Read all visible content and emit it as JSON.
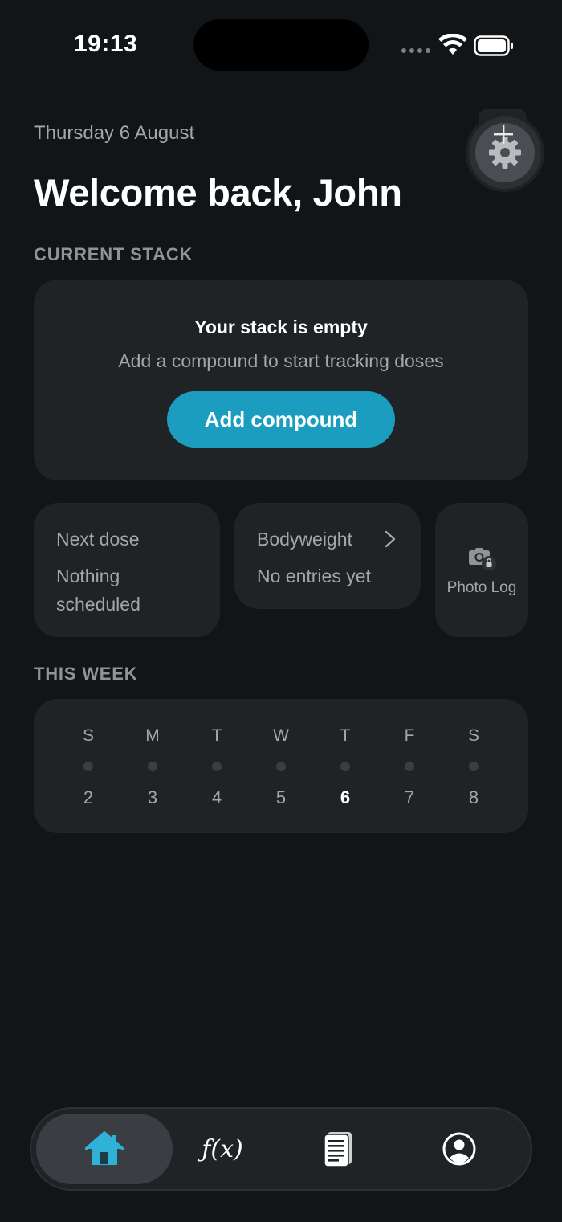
{
  "status_bar": {
    "time": "19:13",
    "icons": [
      "signal-dots-icon",
      "wifi-icon",
      "battery-icon"
    ]
  },
  "header": {
    "date": "Thursday 6 August",
    "welcome": "Welcome back, John",
    "settings_icon": "gear-icon",
    "add_icon": "plus-icon"
  },
  "current_stack": {
    "section_title": "CURRENT STACK",
    "empty_title": "Your stack is empty",
    "empty_subtitle": "Add a compound to start tracking doses",
    "add_button": "Add compound"
  },
  "summary_cards": {
    "next_dose": {
      "label": "Next dose",
      "value": "Nothing scheduled"
    },
    "bodyweight": {
      "label": "Bodyweight",
      "value": "No entries yet",
      "icon": "chevron-right-icon"
    },
    "photo_log": {
      "label": "Photo Log",
      "icon": "camera-lock-icon"
    }
  },
  "this_week": {
    "section_title": "THIS WEEK",
    "days": [
      {
        "letter": "S",
        "num": "2"
      },
      {
        "letter": "M",
        "num": "3"
      },
      {
        "letter": "T",
        "num": "4"
      },
      {
        "letter": "W",
        "num": "5"
      },
      {
        "letter": "T",
        "num": "6"
      },
      {
        "letter": "F",
        "num": "7"
      },
      {
        "letter": "S",
        "num": "8"
      }
    ],
    "today_index": 4
  },
  "tab_bar": {
    "tabs": [
      {
        "name": "home",
        "icon": "home-icon",
        "active": true
      },
      {
        "name": "calculator",
        "label": "ƒ(x)",
        "icon": "function-icon",
        "active": false
      },
      {
        "name": "notes",
        "icon": "document-icon",
        "active": false
      },
      {
        "name": "profile",
        "icon": "profile-icon",
        "active": false
      }
    ]
  },
  "colors": {
    "background": "#121517",
    "card": "#1f2326",
    "accent": "#1b9dc0",
    "home_icon": "#2fb1d8",
    "muted_text": "#a3a7ab"
  }
}
